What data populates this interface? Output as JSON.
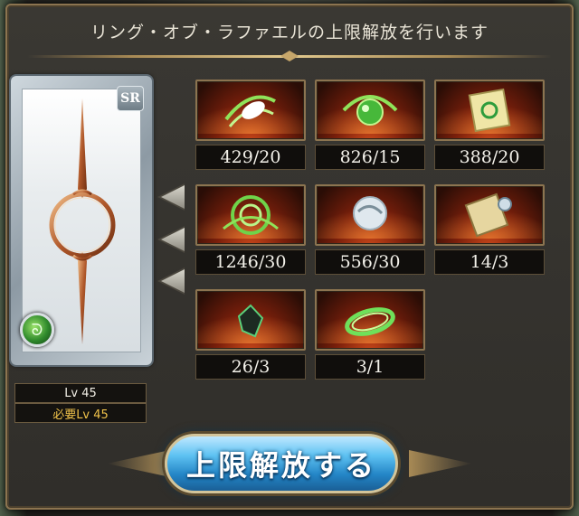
{
  "header": {
    "title": "リング・オブ・ラファエルの上限解放を行います"
  },
  "card": {
    "rarity": "SR",
    "element_icon": "wind-element-icon",
    "level_label": "Lv 45",
    "required_level_label": "必要Lv 45"
  },
  "materials": [
    {
      "icon": "feather-wind-icon",
      "count": "429/20"
    },
    {
      "icon": "green-orb-icon",
      "count": "826/15"
    },
    {
      "icon": "green-scroll-icon",
      "count": "388/20"
    },
    {
      "icon": "wind-swirl-icon",
      "count": "1246/30"
    },
    {
      "icon": "silver-orb-icon",
      "count": "556/30"
    },
    {
      "icon": "parchment-seal-icon",
      "count": "14/3"
    },
    {
      "icon": "dark-crystal-icon",
      "count": "26/3"
    },
    {
      "icon": "green-ring-icon",
      "count": "3/1"
    }
  ],
  "action_button": {
    "label": "上限解放する"
  },
  "colors": {
    "accent_gold": "#8c7450",
    "button_blue": "#2486c7",
    "required_level": "#f0c24a"
  }
}
